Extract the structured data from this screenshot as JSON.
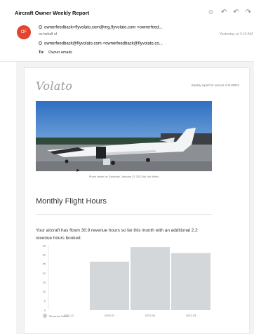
{
  "email": {
    "subject": "Aircraft Owner Weekly Report",
    "avatar_initials": "OF",
    "from_line1": "ownerfeedback=flyvolato.com@mg.flyvolato.com <ownerfeed...",
    "on_behalf": "on behalf of",
    "from_line2": "ownerfeedback@flyvolato.com <ownerfeedback@flyvolato.co...",
    "to_label": "To:",
    "to_value": "Owner emails",
    "timestamp": "Yesterday at 4:10 AM",
    "actions": [
      "smiley-icon",
      "reply-icon",
      "reply-all-icon",
      "forward-icon"
    ]
  },
  "report": {
    "logo": "Volato",
    "tagline": "Weekly report for owners of N135DX",
    "photo_caption": "Photo taken on Saturday, January 22 2022 by Jon Wells",
    "section_title": "Monthly Flight Hours",
    "paragraph": "Your aircraft has flown 30.9 revenue hours so far this month with an additional 2.2 revenue hours booked."
  },
  "chart_data": {
    "type": "bar",
    "categories": [
      "2022-12",
      "2023-01",
      "2023-02",
      "2023-03"
    ],
    "series": [
      {
        "name": "Revenue Hours",
        "values": [
          0,
          26.3,
          34.2,
          30.9
        ]
      }
    ],
    "ylim": [
      0,
      35
    ],
    "yticks": [
      0,
      5,
      10,
      15,
      20,
      25,
      30,
      35
    ],
    "grid": false,
    "legend_position": "bottom-left",
    "bar_color": "#d3d7da"
  }
}
